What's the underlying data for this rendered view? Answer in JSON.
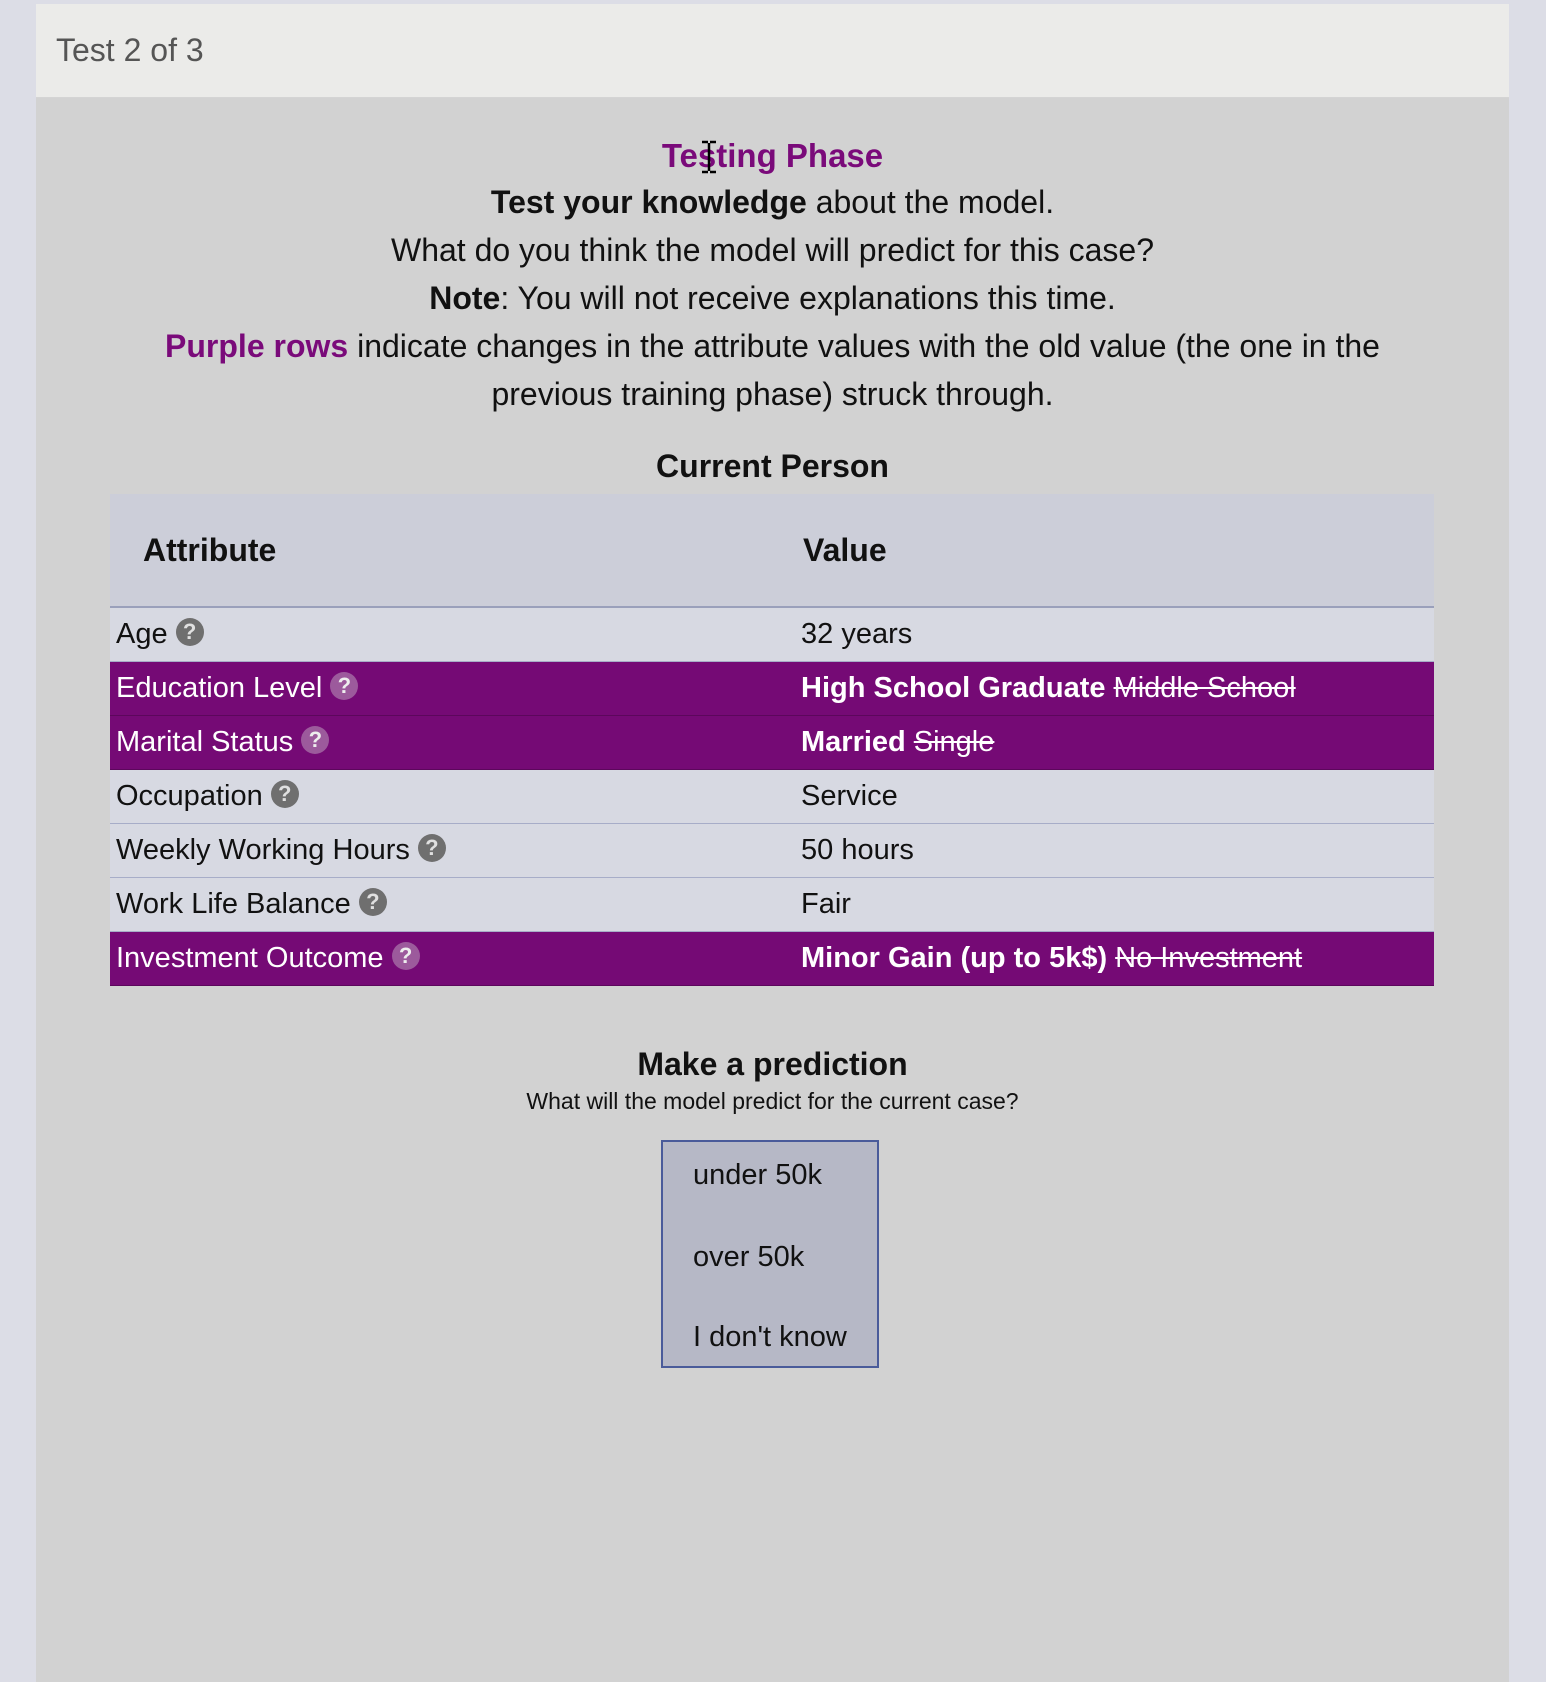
{
  "header": {
    "title": "Test 2 of 3"
  },
  "intro": {
    "heading": "Testing Phase",
    "line1_bold": "Test your knowledge",
    "line1_rest": " about the model.",
    "line2": "What do you think the model will predict for this case?",
    "line3_bold": "Note",
    "line3_rest": ": You will not receive explanations this time.",
    "line4_accent": "Purple rows",
    "line4_rest": " indicate changes in the attribute values with the old value (the one in the previous training phase) struck through."
  },
  "table": {
    "title": "Current Person",
    "col_attribute": "Attribute",
    "col_value": "Value",
    "help_glyph": "?",
    "rows": [
      {
        "attribute": "Age",
        "value": "32 years",
        "old_value": ""
      },
      {
        "attribute": "Education Level",
        "value": "High School Graduate",
        "old_value": "Middle School"
      },
      {
        "attribute": "Marital Status",
        "value": "Married",
        "old_value": "Single"
      },
      {
        "attribute": "Occupation",
        "value": "Service",
        "old_value": ""
      },
      {
        "attribute": "Weekly Working Hours",
        "value": "50 hours",
        "old_value": ""
      },
      {
        "attribute": "Work Life Balance",
        "value": "Fair",
        "old_value": ""
      },
      {
        "attribute": "Investment Outcome",
        "value": "Minor Gain (up to 5k$)",
        "old_value": "No Investment"
      }
    ]
  },
  "prediction": {
    "title": "Make a prediction",
    "subtitle": "What will the model predict for the current case?",
    "options": [
      "under 50k",
      "over 50k",
      "I don't know"
    ]
  },
  "colors": {
    "accent": "#750a75",
    "table_bg": "#d7d9e2",
    "panel_bg": "#d2d2d2"
  }
}
